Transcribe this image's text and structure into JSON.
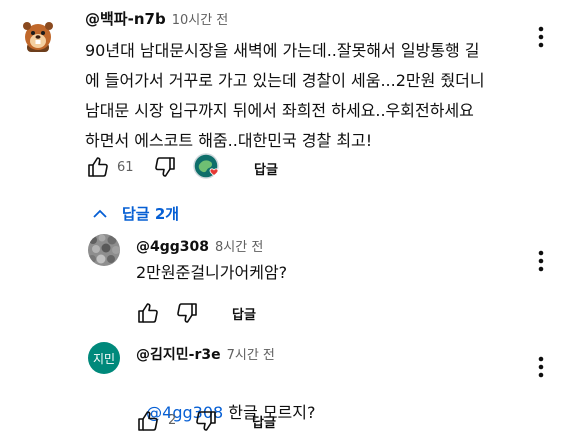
{
  "comment": {
    "handle": "@백파-n7b",
    "time": "10시간 전",
    "lines": [
      "90년대 남대문시장을 새벽에 가는데..잘못해서 일방통행 길",
      "에 들어가서 거꾸로 가고 있는데 경찰이 세움...2만원 줬더니",
      "남대문 시장 입구까지 뒤에서 좌희전 하세요..우회전하세요",
      "하면서 에스코트 해줌..대한민국 경찰 최고!"
    ],
    "like_count": "61",
    "reply_label": "답글"
  },
  "replies_toggle": {
    "label": "답글 2개"
  },
  "replies": [
    {
      "handle": "@4gg308",
      "time": "8시간 전",
      "text": "2만원준걸니가어케암?",
      "reply_label": "답글"
    },
    {
      "avatar_text": "지민",
      "handle": "@김지민-r3e",
      "time": "7시간 전",
      "mention": "@4gg308",
      "text": " 한글 모르지?",
      "like_count": "2",
      "reply_label": "답글"
    }
  ],
  "colors": {
    "link": "#065fd4",
    "avatar_teal": "#00897b",
    "heart": "#e53935"
  }
}
